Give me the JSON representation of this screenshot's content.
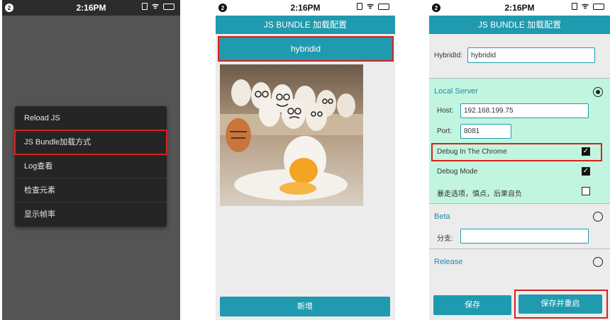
{
  "status_bar": {
    "time": "2:16PM",
    "notification_count": "2"
  },
  "screen1": {
    "menu_items": [
      {
        "label": "Reload JS"
      },
      {
        "label": "JS Bundle加载方式"
      },
      {
        "label": "Log查看"
      },
      {
        "label": "检查元素"
      },
      {
        "label": "显示帧率"
      }
    ]
  },
  "screen2": {
    "title": "JS BUNDLE 加载配置",
    "hybrid_button": "hybridid",
    "add_button": "新增"
  },
  "screen3": {
    "title": "JS BUNDLE 加载配置",
    "hybrid_id_label": "HybridId:",
    "hybrid_id_value": "hybridid",
    "local_server": {
      "title": "Local Server",
      "selected": true,
      "host_label": "Host:",
      "host_value": "192.168.199.75",
      "port_label": "Port:",
      "port_value": "8081",
      "debug_chrome_label": "Debug In The Chrome",
      "debug_chrome_checked": true,
      "debug_mode_label": "Debug Mode",
      "debug_mode_checked": true,
      "risky_option_label": "暴走选项，慎点，后果自负",
      "risky_option_checked": false
    },
    "beta": {
      "title": "Beta",
      "selected": false,
      "branch_label": "分支:"
    },
    "release": {
      "title": "Release",
      "selected": false
    },
    "save_button": "保存",
    "save_restart_button": "保存并重启"
  },
  "colors": {
    "accent": "#1f9aae",
    "highlight": "#d9211e",
    "local_bg": "#c2f5df"
  }
}
